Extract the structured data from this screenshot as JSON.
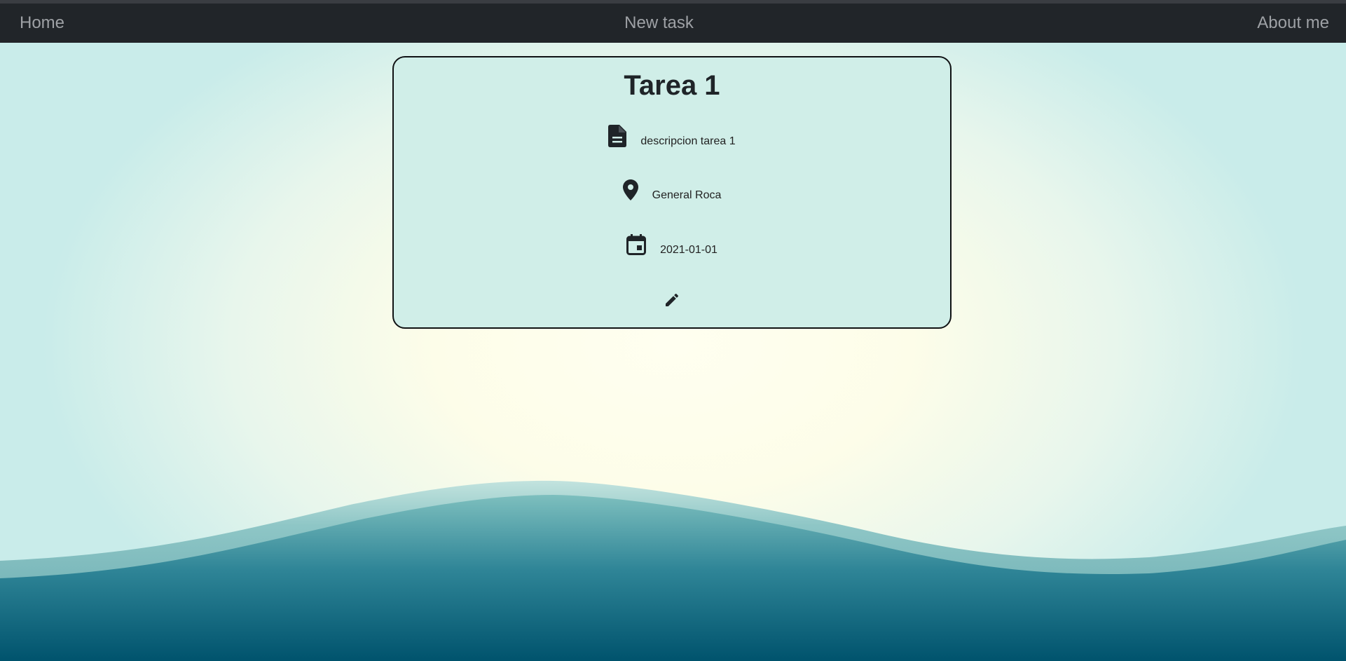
{
  "nav": {
    "home_label": "Home",
    "new_task_label": "New task",
    "about_label": "About me"
  },
  "task": {
    "title": "Tarea 1",
    "description": "descripcion tarea 1",
    "location": "General Roca",
    "date": "2021-01-01"
  },
  "icons": {
    "description": "file-text-icon",
    "location": "map-pin-icon",
    "date": "calendar-icon",
    "edit": "pencil-icon"
  },
  "colors": {
    "navbar_bg": "#212529",
    "nav_text": "#9ea1a5",
    "card_bg": "#d0eee8",
    "wave_dark": "#00546e",
    "wave_light": "#7dbfbe"
  }
}
